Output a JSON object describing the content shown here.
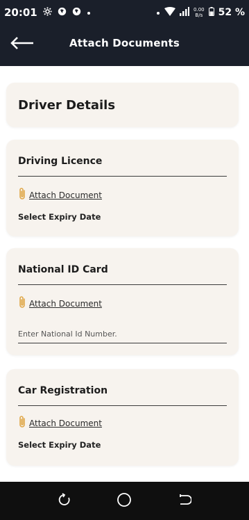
{
  "status_bar": {
    "time": "20:01",
    "left_icons": [
      "gear-icon",
      "notification-icon",
      "notification-icon",
      "dot-icon"
    ],
    "net_speed_value": "0.00",
    "net_speed_unit": "B/s",
    "battery_percent": "52 %"
  },
  "app_bar": {
    "title": "Attach Documents"
  },
  "header_card": {
    "title": "Driver Details"
  },
  "sections": [
    {
      "title": "Driving Licence",
      "attach_label": "Attach Document",
      "expiry_label": "Select Expiry Date"
    },
    {
      "title": "National ID Card",
      "attach_label": "Attach Document",
      "input_placeholder": "Enter National Id Number.",
      "input_value": ""
    },
    {
      "title": "Car Registration",
      "attach_label": "Attach Document",
      "expiry_label": "Select Expiry Date"
    }
  ],
  "colors": {
    "app_bar_bg": "#1a1f2a",
    "card_bg": "#f7f3ee",
    "clip_icon": "#e0a84a",
    "nav_bar_bg": "#0f0f0f"
  }
}
